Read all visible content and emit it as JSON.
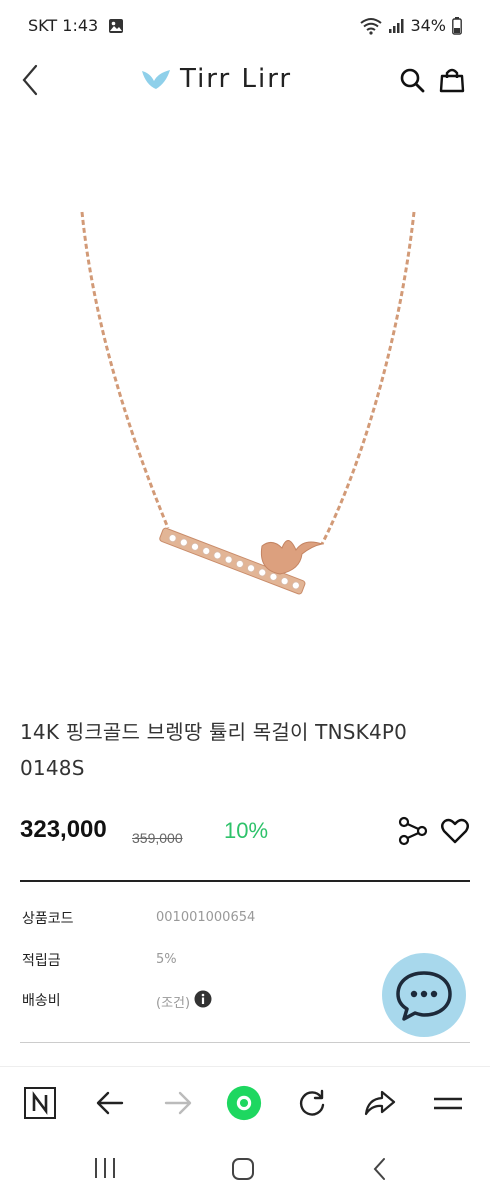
{
  "status": {
    "carrier_time": "SKT 1:43",
    "battery": "34%"
  },
  "header": {
    "logo_text": "Tirr Lirr"
  },
  "product": {
    "title": "14K 핑크골드 브렝땅 튤리 목걸이 TNSK4P0 0148S",
    "price": "323,000",
    "original_price": "359,000",
    "discount": "10%"
  },
  "info": {
    "rows": [
      {
        "label": "상품코드",
        "value": "001001000654"
      },
      {
        "label": "적립금",
        "value": "5%"
      },
      {
        "label": "배송비",
        "value": "(조건)"
      }
    ]
  },
  "colors": {
    "accent_green": "#2ec26a",
    "chat_bubble": "#a8d8ec",
    "rose_gold": "#d9a07a"
  },
  "icons": [
    "gallery-icon",
    "wifi-icon",
    "signal-icon",
    "battery-icon",
    "back-icon",
    "bird-logo-icon",
    "search-icon",
    "bag-icon",
    "share-icon",
    "heart-icon",
    "info-icon",
    "chat-icon",
    "naver-icon",
    "arrow-left-icon",
    "arrow-right-icon",
    "home-dot-icon",
    "refresh-icon",
    "forward-share-icon",
    "menu-icon",
    "recents-icon",
    "home-icon",
    "back-nav-icon"
  ]
}
